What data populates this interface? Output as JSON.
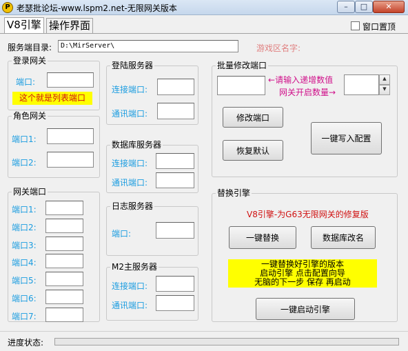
{
  "window": {
    "title": "老瑟批论坛-www.lspm2.net-无限网关版本",
    "app_icon_glyph": "P",
    "minimize_glyph": "–",
    "maximize_glyph": "□",
    "close_glyph": "✕"
  },
  "tabs": [
    {
      "label": "V8引擎"
    },
    {
      "label": "操作界面"
    }
  ],
  "topmost": {
    "label": "窗口置顶",
    "checked": false
  },
  "server_dir": {
    "label": "服务端目录:",
    "value": "D:\\MirServer\\"
  },
  "game_zone": {
    "label": "游戏区名字:"
  },
  "login_gateway": {
    "title": "登录网关",
    "port_label": "端口:",
    "port_value": "",
    "note": "这个就是列表端口"
  },
  "role_gateway": {
    "title": "角色网关",
    "port1_label": "端口1:",
    "port2_label": "端口2:"
  },
  "gateway_ports": {
    "title": "网关端口",
    "labels": [
      "端口1:",
      "端口2:",
      "端口3:",
      "端口4:",
      "端口5:",
      "端口6:",
      "端口7:"
    ]
  },
  "login_server": {
    "title": "登陆服务器",
    "connect_label": "连接端口:",
    "comm_label": "通讯端口:"
  },
  "db_server": {
    "title": "数据库服务器",
    "connect_label": "连接端口:",
    "comm_label": "通讯端口:"
  },
  "log_server": {
    "title": "日志服务器",
    "port_label": "端口:"
  },
  "m2_server": {
    "title": "M2主服务器",
    "connect_label": "连接端口:",
    "comm_label": "通讯端口:"
  },
  "batch_modify": {
    "title": "批量修改端口",
    "hint_increment": "请输入递增数值",
    "hint_count": "网关开启数量",
    "arrow_left": "←",
    "arrow_right": "→",
    "modify_button": "修改端口",
    "restore_button": "恢复默认",
    "write_config_button": "一键写入配置",
    "spin_up": "▲",
    "spin_down": "▼"
  },
  "replace_engine": {
    "title": "替换引擎",
    "desc": "V8引擎-为G63无限网关的修复版",
    "replace_button": "一键替换",
    "db_rename_button": "数据库改名",
    "note_lines": [
      "一键替换好引擎的版本",
      "启动引擎 点击配置向导",
      "无脑的下一步 保存 再启动"
    ],
    "start_button": "一键启动引擎"
  },
  "status": {
    "label": "进度状态:",
    "progress": 0
  }
}
